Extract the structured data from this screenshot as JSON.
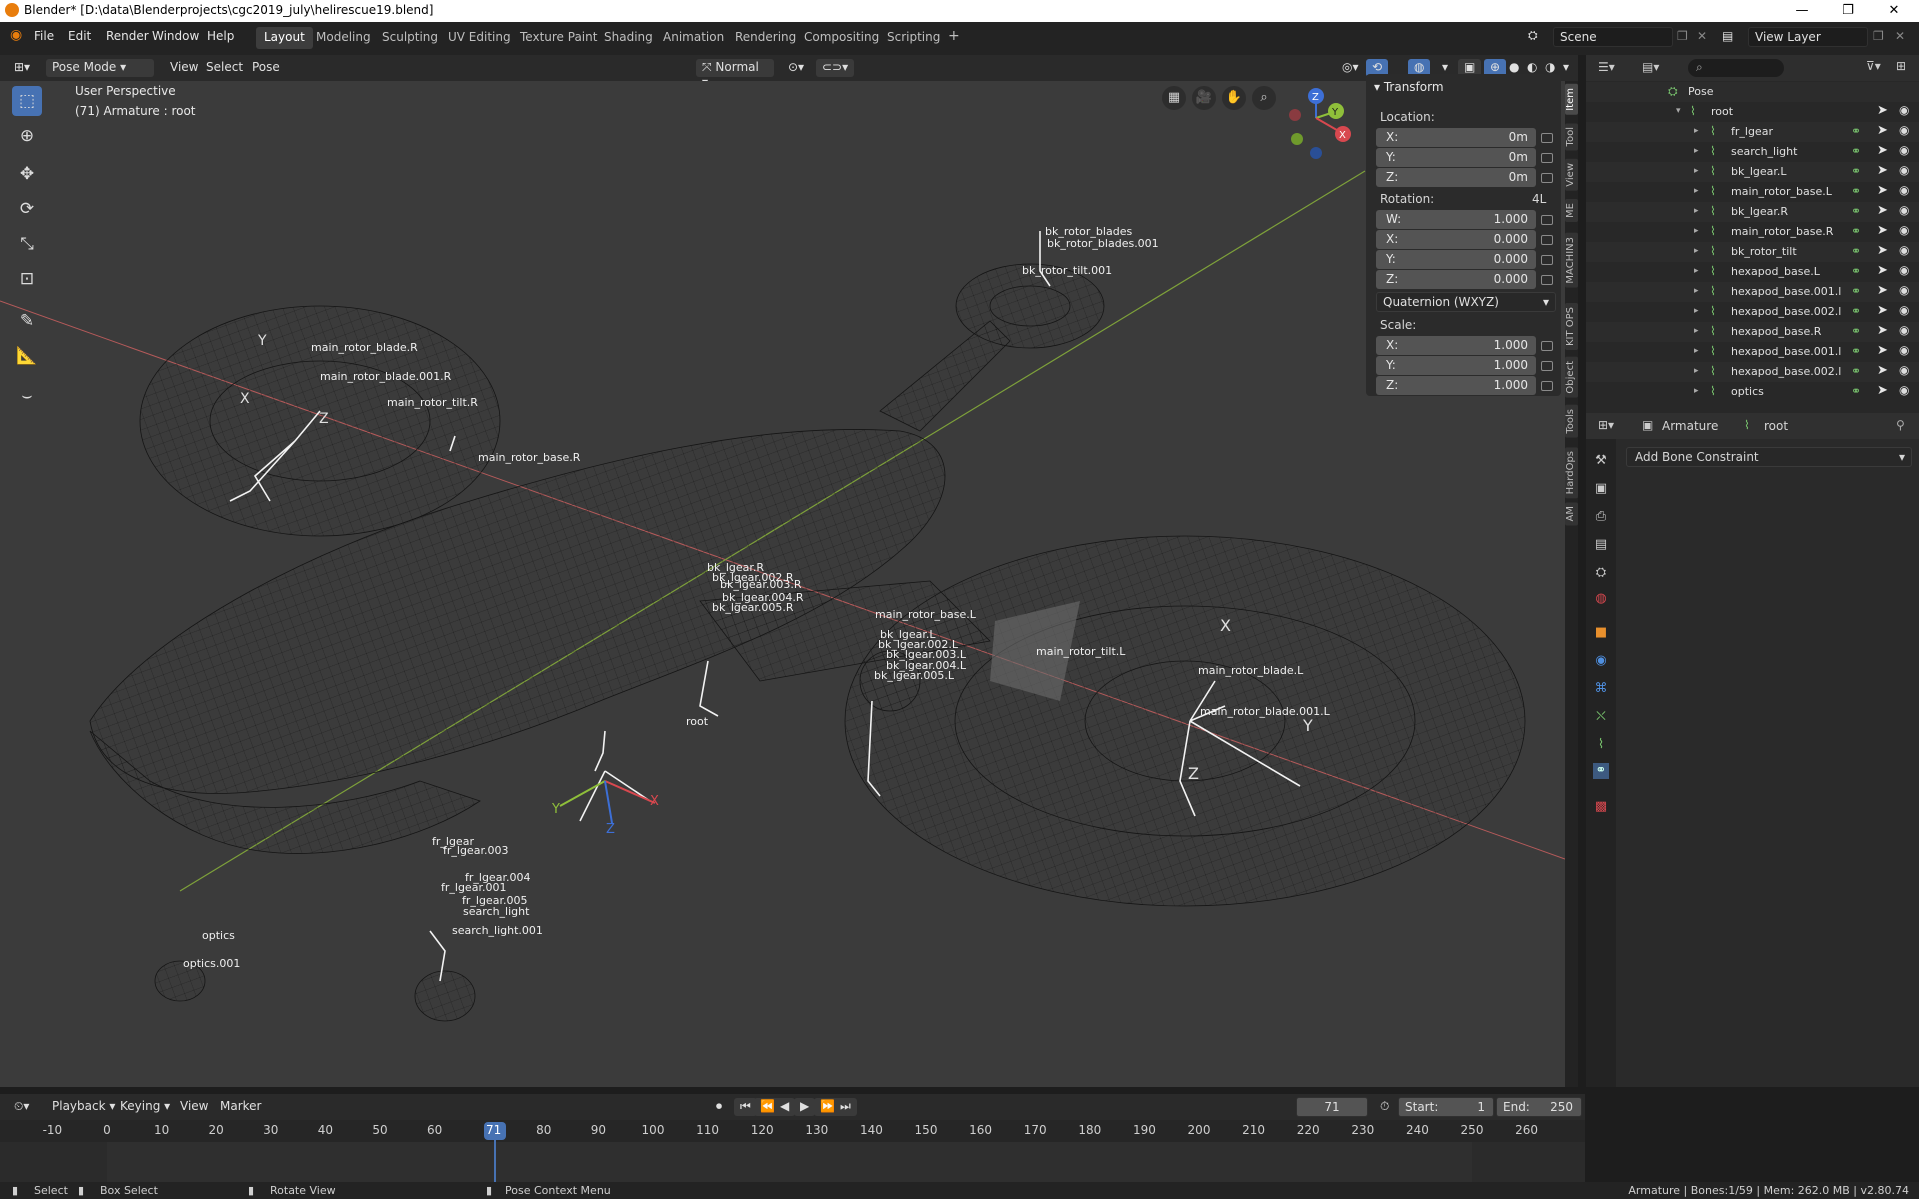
{
  "window": {
    "title": "Blender* [D:\\data\\Blenderprojects\\cgc2019_july\\helirescue19.blend]",
    "controls": [
      "—",
      "❐",
      "✕"
    ]
  },
  "menu": {
    "items": [
      "File",
      "Edit",
      "Render",
      "Window",
      "Help"
    ],
    "workspaces": [
      "Layout",
      "Modeling",
      "Sculpting",
      "UV Editing",
      "Texture Paint",
      "Shading",
      "Animation",
      "Rendering",
      "Compositing",
      "Scripting"
    ],
    "active_workspace": "Layout",
    "add_tab": "+",
    "scene": "Scene",
    "view_layer": "View Layer"
  },
  "viewport_header": {
    "mode": "Pose Mode",
    "menus": [
      "View",
      "Select",
      "Pose"
    ],
    "orientation": "Normal"
  },
  "viewport": {
    "perspective": "User Perspective",
    "object_info": "(71) Armature : root",
    "bone_labels": [
      "main_rotor_blade.R",
      "main_rotor_blade.001.R",
      "main_rotor_tilt.R",
      "main_rotor_base.R",
      "bk_rotor_blades",
      "bk_rotor_blades.001",
      "bk_rotor_tilt.001",
      "bk_lgear.R",
      "bk_lgear.002.R",
      "bk_lgear.003.R",
      "bk_lgear.004.R",
      "bk_lgear.005.R",
      "main_rotor_base.L",
      "bk_lgear.L",
      "bk_lgear.002.L",
      "bk_lgear.003.L",
      "bk_lgear.004.L",
      "bk_lgear.005.L",
      "main_rotor_tilt.L",
      "main_rotor_blade.L",
      "main_rotor_blade.001.L",
      "root",
      "fr_lgear",
      "fr_lgear.003",
      "fr_lgear.004",
      "fr_lgear.001",
      "fr_lgear.005",
      "search_light",
      "search_light.001",
      "optics",
      "optics.001"
    ],
    "gizmo_axes": {
      "x": "X",
      "y": "Y",
      "z": "Z"
    }
  },
  "transform_panel": {
    "title": "Transform",
    "location_label": "Location:",
    "location": [
      {
        "k": "X:",
        "v": "0m"
      },
      {
        "k": "Y:",
        "v": "0m"
      },
      {
        "k": "Z:",
        "v": "0m"
      }
    ],
    "rotation_label": "Rotation:",
    "rotation_mode_short": "4L",
    "rotation": [
      {
        "k": "W:",
        "v": "1.000"
      },
      {
        "k": "X:",
        "v": "0.000"
      },
      {
        "k": "Y:",
        "v": "0.000"
      },
      {
        "k": "Z:",
        "v": "0.000"
      }
    ],
    "rotation_mode": "Quaternion (WXYZ)",
    "scale_label": "Scale:",
    "scale": [
      {
        "k": "X:",
        "v": "1.000"
      },
      {
        "k": "Y:",
        "v": "1.000"
      },
      {
        "k": "Z:",
        "v": "1.000"
      }
    ]
  },
  "sidebar_tabs": [
    "Item",
    "Tool",
    "View",
    "ME",
    "MACHIN3",
    "KIT OPS",
    "Object",
    "Tools",
    "HardOps",
    "AM"
  ],
  "outliner": {
    "pose": "Pose",
    "root": "root",
    "bones": [
      "fr_lgear",
      "search_light",
      "bk_lgear.L",
      "main_rotor_base.L",
      "bk_lgear.R",
      "main_rotor_base.R",
      "bk_rotor_tilt",
      "hexapod_base.L",
      "hexapod_base.001.l",
      "hexapod_base.002.l",
      "hexapod_base.R",
      "hexapod_base.001.l",
      "hexapod_base.002.l",
      "optics"
    ]
  },
  "properties": {
    "object": "Armature",
    "bone": "root",
    "add_constraint": "Add Bone Constraint"
  },
  "timeline": {
    "menus": [
      "Playback",
      "Keying",
      "View",
      "Marker"
    ],
    "current_frame": "71",
    "start_label": "Start:",
    "start": "1",
    "end_label": "End:",
    "end": "250",
    "ticks": [
      "-10",
      "0",
      "10",
      "20",
      "30",
      "40",
      "50",
      "60",
      "71",
      "80",
      "90",
      "100",
      "110",
      "120",
      "130",
      "140",
      "150",
      "160",
      "170",
      "180",
      "190",
      "200",
      "210",
      "220",
      "230",
      "240",
      "250",
      "260"
    ]
  },
  "statusbar": {
    "select": "Select",
    "box_select": "Box Select",
    "rotate_view": "Rotate View",
    "context_menu": "Pose Context Menu",
    "stats": "Armature | Bones:1/59 | Mem: 262.0 MB | v2.80.74"
  },
  "colors": {
    "accent": "#4772b3",
    "x_axis": "#d8484f",
    "y_axis": "#8fbf3a",
    "z_axis": "#3d6fd6",
    "bone_green": "#79c46e"
  }
}
